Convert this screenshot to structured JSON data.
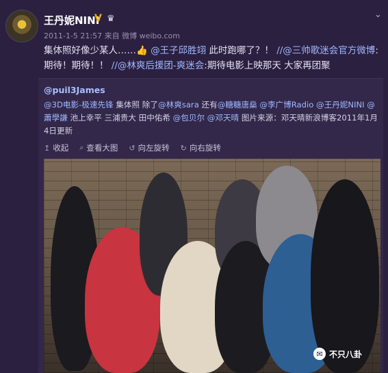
{
  "post": {
    "username": "王丹妮NINI",
    "verified_badge": "V",
    "meta": "2011-1-5 21:57 来自 微博 weibo.com",
    "text_plain_1": "集体照好像少某人……",
    "emoji": "👍",
    "mention_1": "@王子邱胜翊",
    "text_plain_2": " 此时跑哪了？！ ",
    "repost_1": "//@三帅歌迷会官方微博",
    "text_plain_3": ":期待！期待！！ ",
    "repost_2": "//@林爽后援团-爽迷会",
    "text_plain_4": ":期待电影上映那天 大家再团聚"
  },
  "repost": {
    "user": "@puil3James",
    "mention_3d": "@3D电影-极速先锋",
    "t1": " 集体照 除了",
    "m_linshuang": "@林爽sara",
    "t2": " 还有",
    "m_tangtang": "@糖糖唐燊",
    "t3": " ",
    "m_liguangbo": "@李广博Radio",
    "t4": " ",
    "m_wangdanni": "@王丹妮NINI",
    "t5": " ",
    "m_xiaoxuelian": "@蕭學謙",
    "t6": " 池上幸平 三浦贵大 田中佑希 ",
    "m_baobeier": "@包贝尔",
    "t7": " ",
    "m_dengtianqing": "@邓天晴",
    "t8": " 图片来源：邓天晴新浪博客2011年1月4日更新"
  },
  "actions": {
    "collapse": "收起",
    "view_large": "查看大图",
    "rotate_left": "向左旋转",
    "rotate_right": "向右旋转"
  },
  "watermark": {
    "label": "不只八卦"
  },
  "colors": {
    "background": "#2b2040",
    "link": "#9fb7ff",
    "badge": "#f1b400"
  }
}
